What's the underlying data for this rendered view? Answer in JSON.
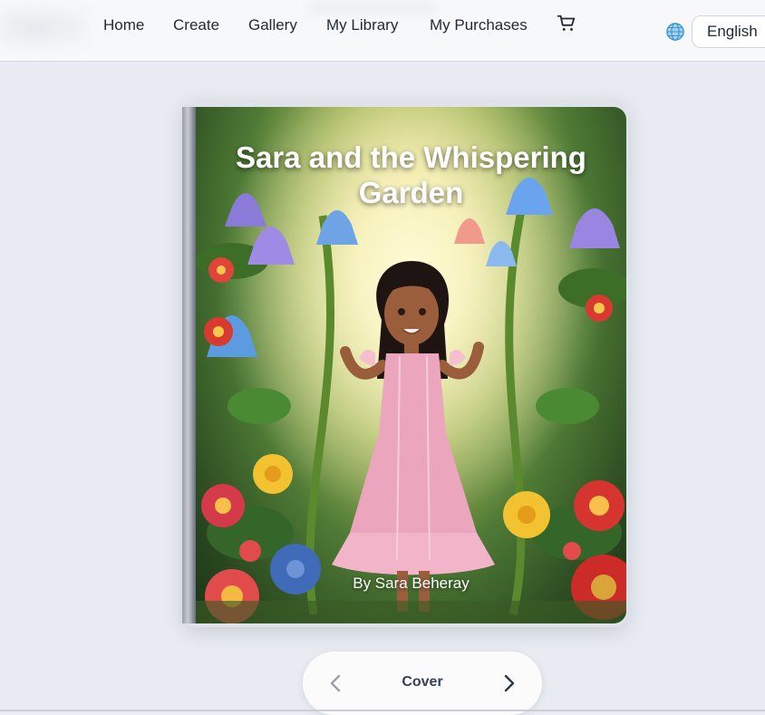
{
  "nav": {
    "items": [
      {
        "label": "Home"
      },
      {
        "label": "Create"
      },
      {
        "label": "Gallery"
      },
      {
        "label": "My Library"
      },
      {
        "label": "My Purchases"
      }
    ],
    "cart_icon": "cart-icon"
  },
  "language": {
    "icon": "globe-icon",
    "selected": "English"
  },
  "book": {
    "title": "Sara and the Whispering Garden",
    "author": "By Sara Beheray"
  },
  "pager": {
    "label": "Cover",
    "prev_icon": "chevron-left-icon",
    "next_icon": "chevron-right-icon"
  },
  "colors": {
    "background": "#e8ecf2",
    "text": "#1f2937"
  }
}
